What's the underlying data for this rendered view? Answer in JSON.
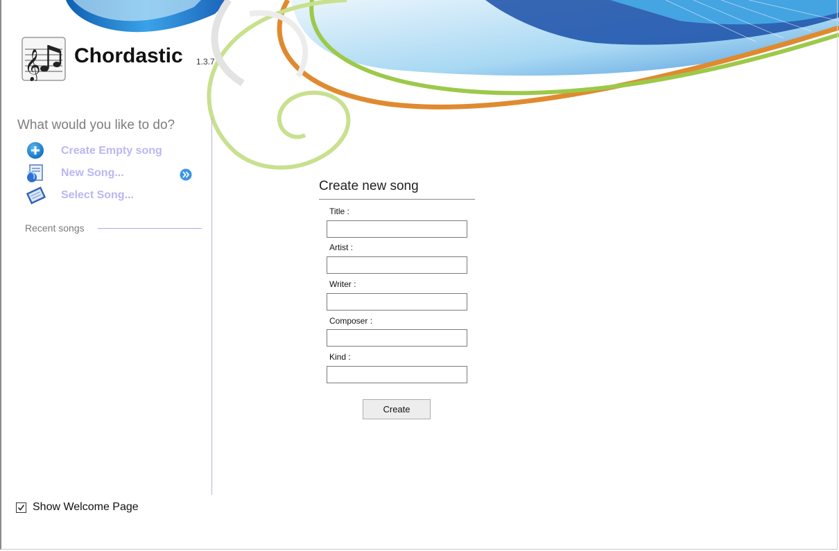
{
  "app": {
    "name": "Chordastic",
    "version": "1.3.7",
    "logo_icon": "music-notes-icon"
  },
  "sidebar": {
    "prompt": "What would you like to do?",
    "actions": [
      {
        "label": "Create Empty song",
        "icon": "add-circle-icon"
      },
      {
        "label": "New Song...",
        "icon": "new-document-icon"
      },
      {
        "label": "Select Song...",
        "icon": "open-song-icon"
      }
    ],
    "expand_icon": "double-chevron-right-icon",
    "recent_label": "Recent songs"
  },
  "form": {
    "title": "Create new song",
    "fields": [
      {
        "label": "Title :",
        "value": ""
      },
      {
        "label": "Artist :",
        "value": ""
      },
      {
        "label": "Writer :",
        "value": ""
      },
      {
        "label": "Composer :",
        "value": ""
      },
      {
        "label": "Kind :",
        "value": ""
      }
    ],
    "submit_label": "Create"
  },
  "footer": {
    "show_welcome_label": "Show Welcome Page",
    "show_welcome_checked": true
  },
  "colors": {
    "action_text": "#b9b7f3",
    "divider": "#b3b1ee",
    "banner_blue": "#1a7fd0",
    "swirl_orange": "#e08a30",
    "swirl_green": "#9cc94a"
  }
}
